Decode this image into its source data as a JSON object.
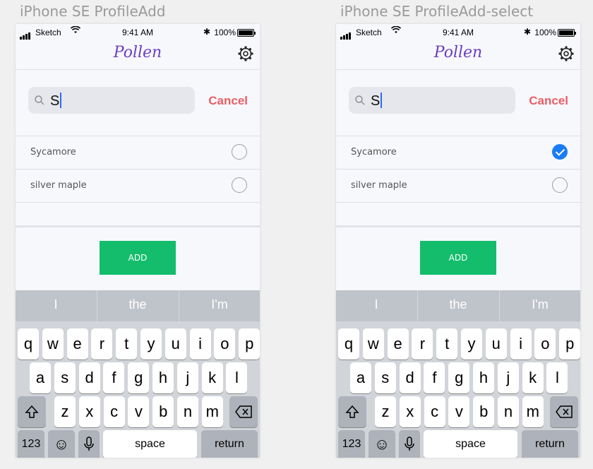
{
  "artboards": [
    {
      "label": "iPhone SE ProfileAdd",
      "status": {
        "carrier": "Sketch",
        "time": "9:41 AM",
        "battery": "100%"
      },
      "logo": "Pollen",
      "search": {
        "value": "S",
        "cancel_label": "Cancel"
      },
      "results": [
        {
          "label": "Sycamore",
          "selected": false
        },
        {
          "label": "silver maple",
          "selected": false
        }
      ],
      "add_label": "ADD",
      "predictions": [
        "I",
        "the",
        "I'm"
      ],
      "keyboard": {
        "row1": [
          "q",
          "w",
          "e",
          "r",
          "t",
          "y",
          "u",
          "i",
          "o",
          "p"
        ],
        "row2": [
          "a",
          "s",
          "d",
          "f",
          "g",
          "h",
          "j",
          "k",
          "l"
        ],
        "row3": [
          "z",
          "x",
          "c",
          "v",
          "b",
          "n",
          "m"
        ],
        "numbers_label": "123",
        "space_label": "space",
        "return_label": "return"
      }
    },
    {
      "label": "iPhone SE ProfileAdd-select",
      "status": {
        "carrier": "Sketch",
        "time": "9:41 AM",
        "battery": "100%"
      },
      "logo": "Pollen",
      "search": {
        "value": "S",
        "cancel_label": "Cancel"
      },
      "results": [
        {
          "label": "Sycamore",
          "selected": true
        },
        {
          "label": "silver maple",
          "selected": false
        }
      ],
      "add_label": "ADD",
      "predictions": [
        "I",
        "the",
        "I'm"
      ],
      "keyboard": {
        "row1": [
          "q",
          "w",
          "e",
          "r",
          "t",
          "y",
          "u",
          "i",
          "o",
          "p"
        ],
        "row2": [
          "a",
          "s",
          "d",
          "f",
          "g",
          "h",
          "j",
          "k",
          "l"
        ],
        "row3": [
          "z",
          "x",
          "c",
          "v",
          "b",
          "n",
          "m"
        ],
        "numbers_label": "123",
        "space_label": "space",
        "return_label": "return"
      }
    }
  ],
  "colors": {
    "brand": "#6b3fc2",
    "cancel": "#e85e66",
    "add": "#13bd6c",
    "check": "#1a7cf5"
  }
}
